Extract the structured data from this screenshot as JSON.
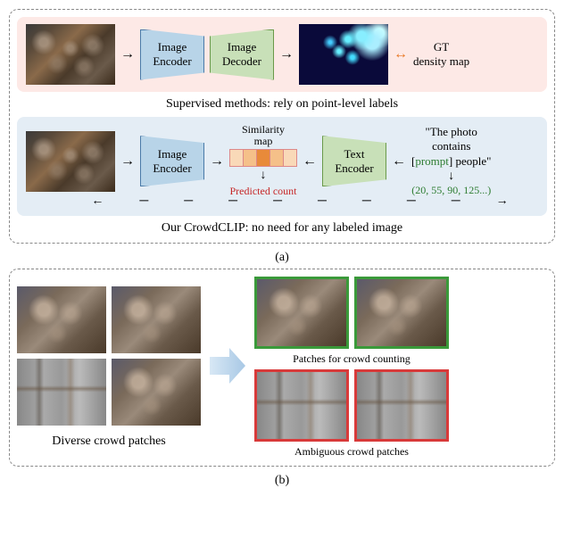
{
  "panel_a": {
    "supervised": {
      "encoder_label": "Image\nEncoder",
      "decoder_label": "Image\nDecoder",
      "gt_label": "GT\ndensity map",
      "caption": "Supervised methods: rely on point-level labels"
    },
    "crowdclip": {
      "encoder_label": "Image\nEncoder",
      "text_encoder_label": "Text\nEncoder",
      "sim_label": "Similarity\nmap",
      "predicted_label": "Predicted count",
      "prompt_text_pre": "\"The photo\ncontains\n[",
      "prompt_word": "prompt",
      "prompt_text_post": "] people\"",
      "numbers": "(20, 55, 90, 125...)",
      "caption": "Our CrowdCLIP:  no need for any labeled image"
    },
    "label": "(a)"
  },
  "panel_b": {
    "left_caption": "Diverse crowd patches",
    "right_top_caption": "Patches for crowd counting",
    "right_bottom_caption": "Ambiguous crowd patches",
    "label": "(b)"
  }
}
